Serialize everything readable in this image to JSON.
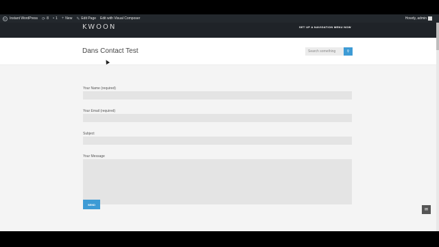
{
  "adminbar": {
    "site_name": "Instant WordPress",
    "updates_count": "8",
    "comments_count": "1",
    "new_label": "New",
    "edit_page_label": "Edit Page",
    "edit_vc_label": "Edit with Visual Composer",
    "howdy": "Howdy, admin"
  },
  "header": {
    "logo": "KWOON",
    "nav_message": "SET UP A NAVIGATION MENU NOW"
  },
  "titlebar": {
    "title": "Dans Contact Test",
    "search_placeholder": "Search something"
  },
  "form": {
    "name_label": "Your Name (required)",
    "email_label": "Your Email (required)",
    "subject_label": "Subject",
    "message_label": "Your Message",
    "send_label": "SEND"
  },
  "icons": {
    "wp": "wordpress-icon",
    "updates": "refresh-icon",
    "comments": "comment-icon",
    "new": "plus-icon",
    "edit": "pencil-icon",
    "search": "search-icon",
    "mail": "mail-icon"
  },
  "colors": {
    "accent": "#3d9bd5",
    "adminbar": "#23282d",
    "header": "#1f2328"
  }
}
